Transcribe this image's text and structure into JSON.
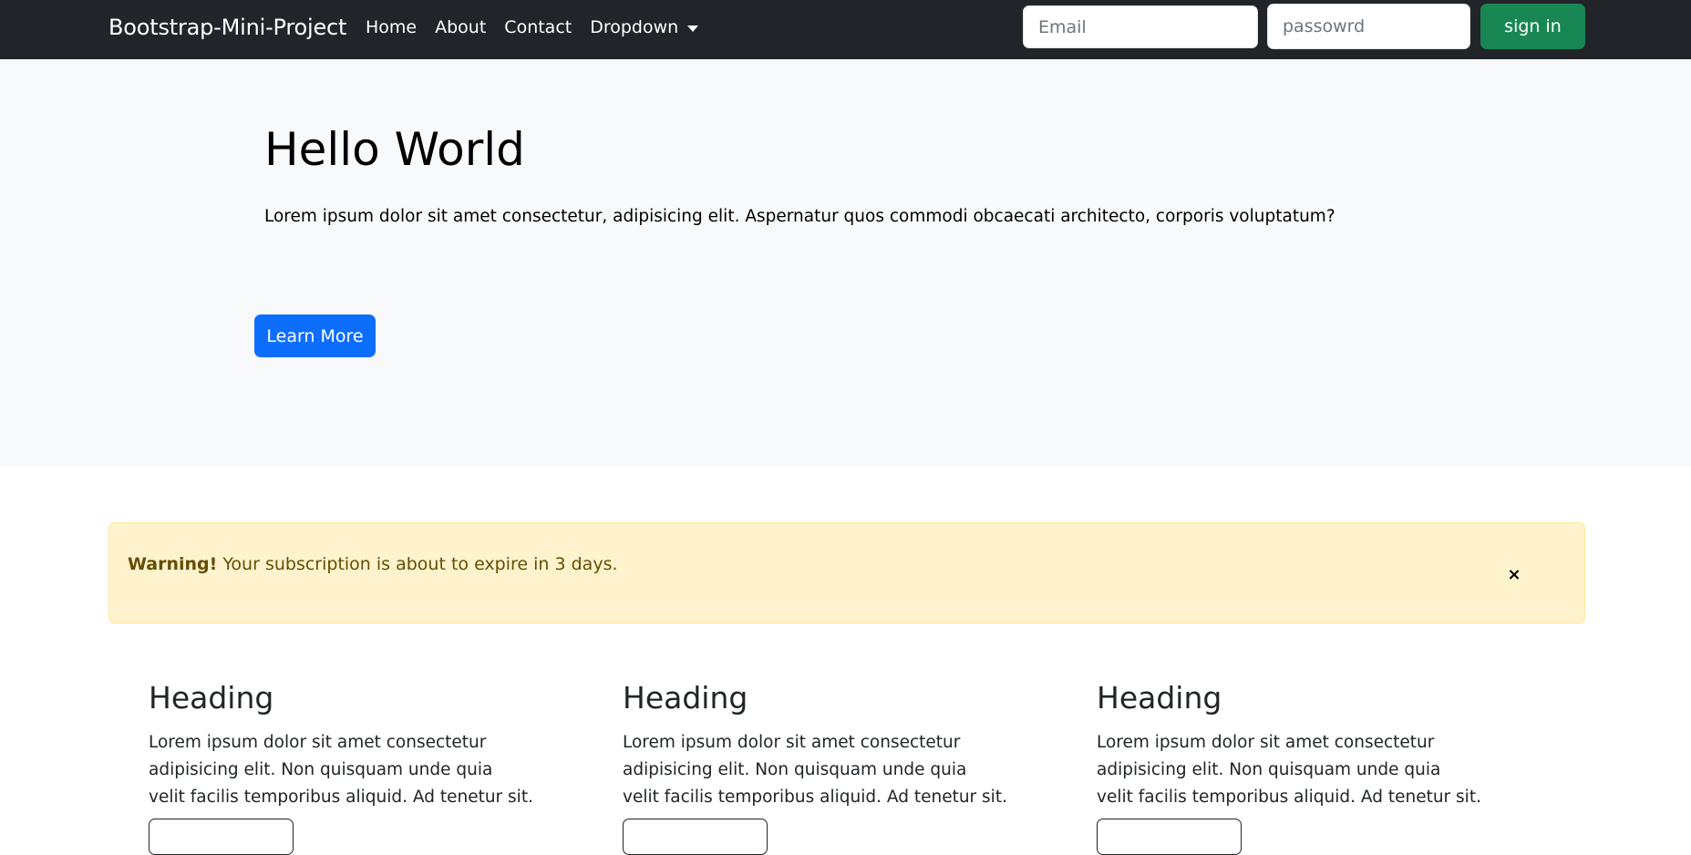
{
  "navbar": {
    "brand": "Bootstrap-Mini-Project",
    "links": [
      "Home",
      "About",
      "Contact"
    ],
    "dropdown_label": "Dropdown",
    "email_placeholder": "Email",
    "password_placeholder": "passowrd",
    "signin_label": "sign in"
  },
  "hero": {
    "title": "Hello World",
    "text": "Lorem ipsum dolor sit amet consectetur, adipisicing elit. Aspernatur quos commodi obcaecati architecto, corporis voluptatum?",
    "button_label": "Learn More"
  },
  "alert": {
    "strong": "Warning!",
    "message": " Your subscription is about to expire in 3 days.",
    "close_symbol": "×"
  },
  "columns": [
    {
      "heading": "Heading",
      "text_lines": [
        "Lorem ipsum dolor sit amet consectetur",
        "adipisicing elit. Non quisquam unde quia",
        "velit facilis temporibus aliquid. Ad tenetur sit."
      ]
    },
    {
      "heading": "Heading",
      "text_lines": [
        "Lorem ipsum dolor sit amet consectetur",
        "adipisicing elit. Non quisquam unde quia",
        "velit facilis temporibus aliquid. Ad tenetur sit."
      ]
    },
    {
      "heading": "Heading",
      "text_lines": [
        "Lorem ipsum dolor sit amet consectetur",
        "adipisicing elit. Non quisquam unde quia",
        "velit facilis temporibus aliquid. Ad tenetur sit."
      ]
    }
  ],
  "colors": {
    "navbar_bg": "#212529",
    "hero_bg": "#f8f9fa",
    "primary": "#0d6efd",
    "success": "#198754",
    "warning_bg": "#fff3cd",
    "warning_text": "#664d03"
  }
}
